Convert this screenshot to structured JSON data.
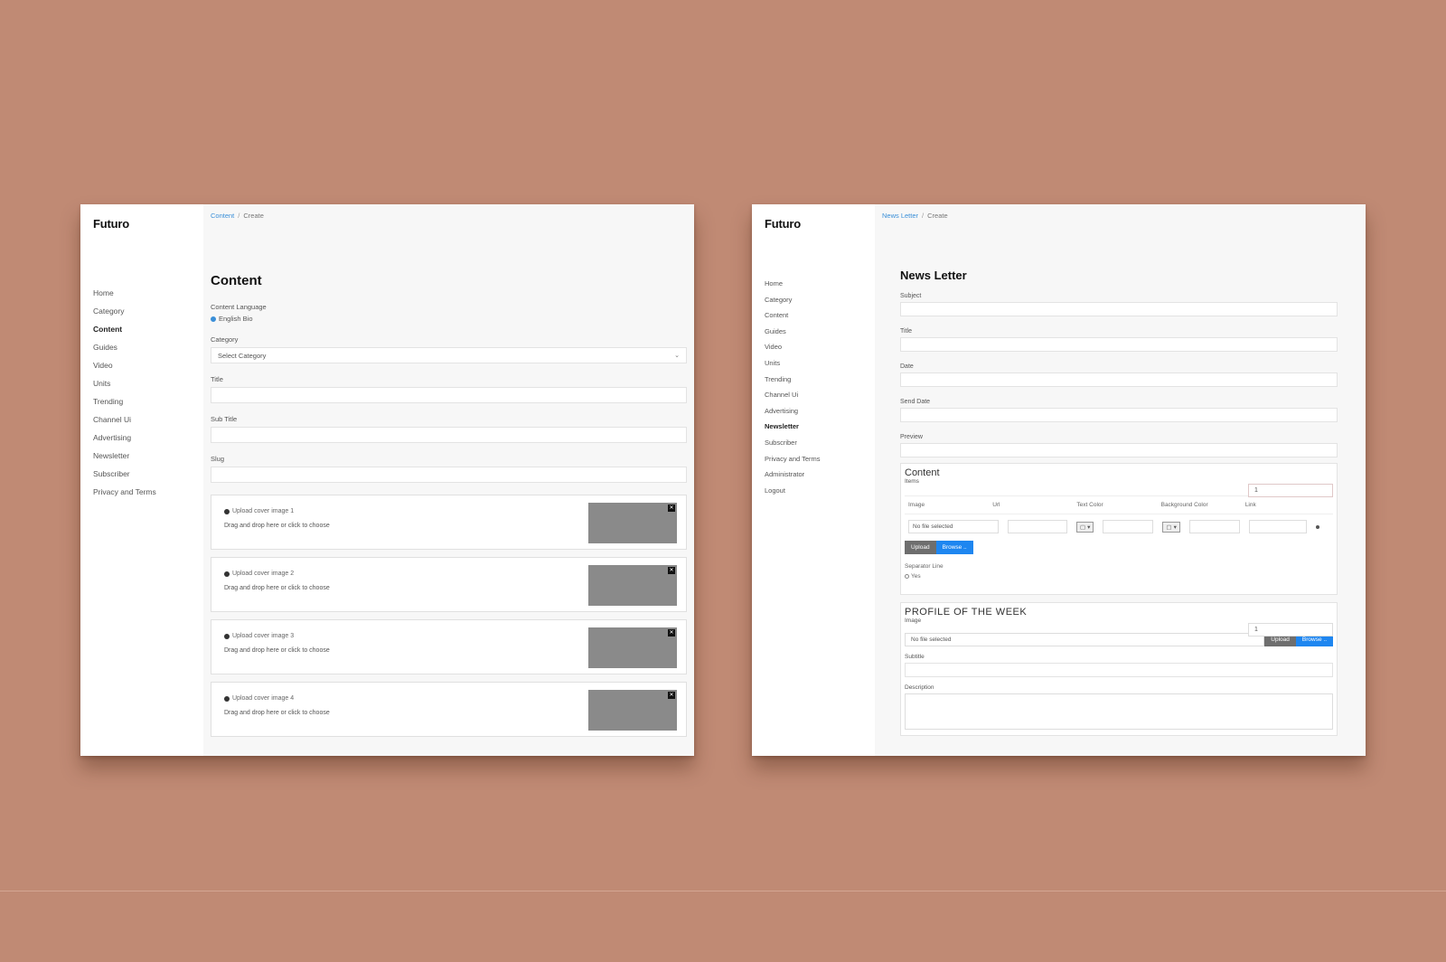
{
  "left": {
    "logo": "Futuro",
    "breadcrumb": {
      "link": "Content",
      "current": "Create"
    },
    "nav": [
      "Home",
      "Category",
      "Content",
      "Guides",
      "Video",
      "Units",
      "Trending",
      "Channel Ui",
      "Advertising",
      "Newsletter",
      "Subscriber",
      "Privacy and Terms"
    ],
    "title": "Content",
    "language_label": "Content Language",
    "language_value": "English  Bio",
    "category_label": "Category",
    "category_placeholder": "Select Category",
    "title_label": "Title",
    "subtitle_label": "Sub Title",
    "slug_label": "Slug",
    "media": [
      {
        "title": "Upload cover image 1",
        "note": "Drag and drop here or click to choose"
      },
      {
        "title": "Upload cover image 2",
        "note": "Drag and drop here or click to choose"
      },
      {
        "title": "Upload cover image 3",
        "note": "Drag and drop here or click to choose"
      },
      {
        "title": "Upload cover image 4",
        "note": "Drag and drop here or click to choose"
      }
    ]
  },
  "right": {
    "logo": "Futuro",
    "breadcrumb": {
      "link": "News Letter",
      "current": "Create"
    },
    "nav": [
      "Home",
      "Category",
      "Content",
      "Guides",
      "Video",
      "Units",
      "Trending",
      "Channel Ui",
      "Advertising",
      "Newsletter",
      "Subscriber",
      "Privacy and Terms",
      "Administrator",
      "Logout"
    ],
    "title": "News Letter",
    "fields": [
      "Subject",
      "Title",
      "Date",
      "Send Date",
      "Preview"
    ],
    "content_section": {
      "title": "Content",
      "items_label": "Items",
      "items_value": "1",
      "columns": [
        "Image",
        "Url",
        "Text Color",
        "Background Color",
        "Link"
      ],
      "file_placeholder": "No file selected",
      "upload_button": "Upload",
      "browse_button": "Browse ..",
      "separator_label": "Separator Line",
      "separator_option": "Yes"
    },
    "profile_section": {
      "title": "PROFILE OF THE WEEK",
      "image_label": "Image",
      "image_value": "1",
      "file_placeholder": "No file selected",
      "upload_button": "Upload",
      "browse_button": "Browse ..",
      "subtitle_label": "Subtitle",
      "description_label": "Description"
    }
  },
  "colors": {
    "background": "#c08a74",
    "accent": "#1e86f0",
    "link": "#3a8fd8"
  }
}
